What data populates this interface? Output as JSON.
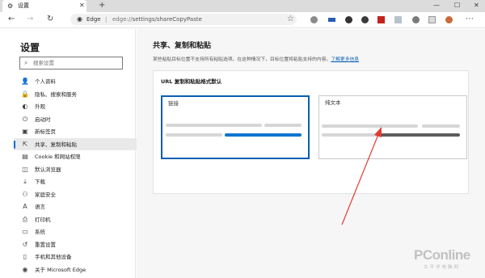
{
  "browser": {
    "tab_title": "设置",
    "tab_icon": "gear-icon",
    "brand": "Edge",
    "url_scheme": "edge://",
    "url_path": "settings/shareCopyPaste"
  },
  "sidebar": {
    "title": "设置",
    "search_placeholder": "搜索设置",
    "items": [
      {
        "label": "个人资料",
        "icon": "user-icon",
        "glyph": "👤"
      },
      {
        "label": "隐私、搜索和服务",
        "icon": "lock-icon",
        "glyph": "🔒"
      },
      {
        "label": "外观",
        "icon": "palette-icon",
        "glyph": "◐"
      },
      {
        "label": "启动时",
        "icon": "power-icon",
        "glyph": "⏻"
      },
      {
        "label": "新标签页",
        "icon": "new-tab-icon",
        "glyph": "▣"
      },
      {
        "label": "共享、复制和粘贴",
        "icon": "share-icon",
        "glyph": "⇱"
      },
      {
        "label": "Cookie 和网站权限",
        "icon": "site-permissions-icon",
        "glyph": "▤"
      },
      {
        "label": "默认浏览器",
        "icon": "browser-icon",
        "glyph": "◫"
      },
      {
        "label": "下载",
        "icon": "download-icon",
        "glyph": "⤓"
      },
      {
        "label": "家庭安全",
        "icon": "family-icon",
        "glyph": "⚇"
      },
      {
        "label": "语言",
        "icon": "language-icon",
        "glyph": "A"
      },
      {
        "label": "打印机",
        "icon": "printer-icon",
        "glyph": "⎙"
      },
      {
        "label": "系统",
        "icon": "system-icon",
        "glyph": "▭"
      },
      {
        "label": "重置设置",
        "icon": "reset-icon",
        "glyph": "↺"
      },
      {
        "label": "手机和其他设备",
        "icon": "phone-icon",
        "glyph": "▯"
      },
      {
        "label": "关于 Microsoft Edge",
        "icon": "edge-icon",
        "glyph": "◉"
      }
    ],
    "active_index": 5
  },
  "main": {
    "title": "共享、复制和粘贴",
    "description": "某些粘贴目标位置不支持所有粘贴选项。在这种情况下，目标位置将粘贴支持的内容。",
    "learn_more": "了解更多信息",
    "card": {
      "title": "URL 复制和粘贴格式默认",
      "options": [
        {
          "label": "链接",
          "selected": true
        },
        {
          "label": "纯文本",
          "selected": false
        }
      ]
    }
  },
  "watermark": {
    "logo": "PConline",
    "sub": "太平洋电脑网"
  },
  "colors": {
    "accent": "#0a5fb4",
    "link_bar": "#0a75d0",
    "annotation_arrow": "#e03b32"
  }
}
